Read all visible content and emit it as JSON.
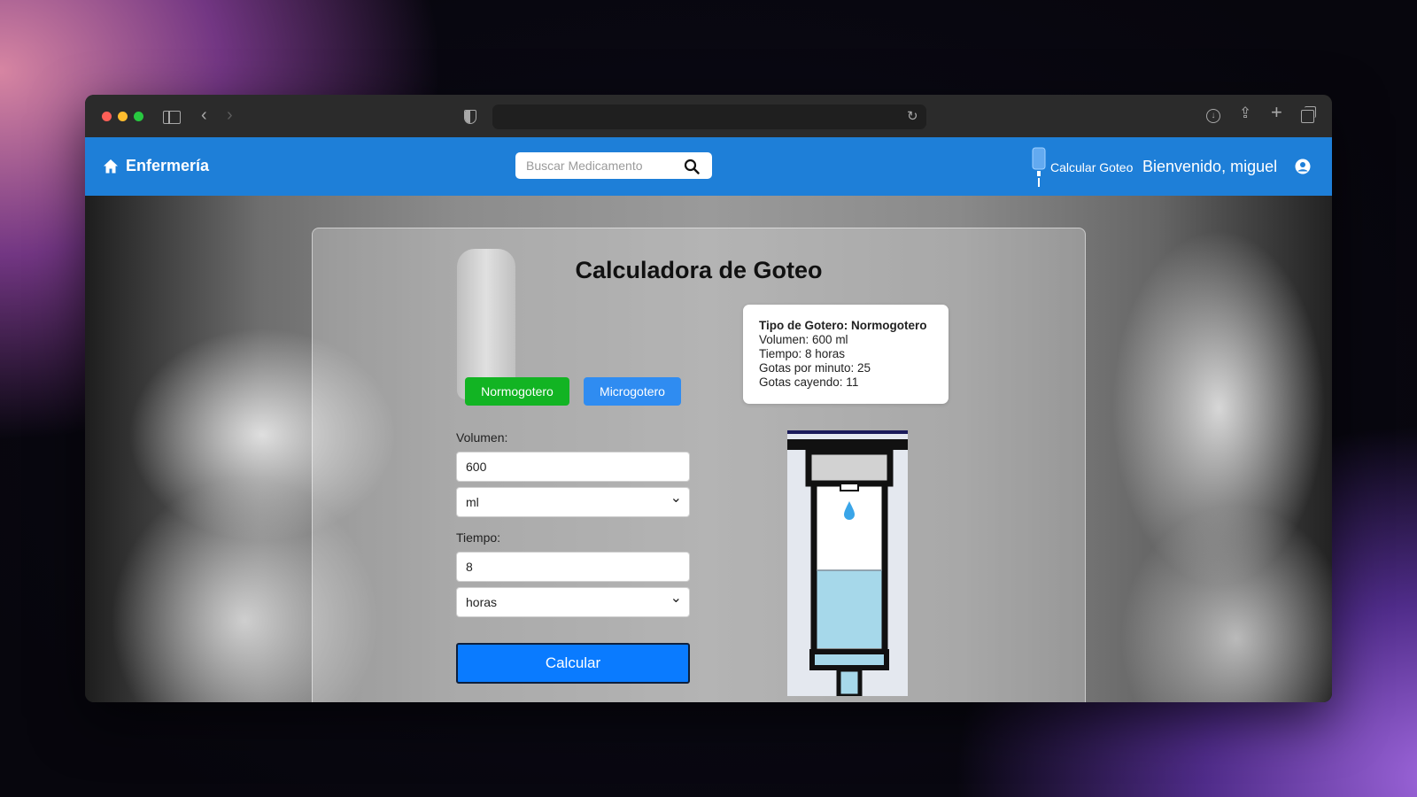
{
  "app": {
    "brand": "Enfermería",
    "search_placeholder": "Buscar Medicamento",
    "drip_link_label": "Calcular Goteo",
    "welcome_text": "Bienvenido, miguel"
  },
  "calculator": {
    "title": "Calculadora de Goteo",
    "types": [
      {
        "label": "Normogotero",
        "color": "#12b423"
      },
      {
        "label": "Microgotero",
        "color": "#2f8cf1"
      }
    ],
    "volume_label": "Volumen:",
    "volume_value": "600",
    "volume_unit": "ml",
    "time_label": "Tiempo:",
    "time_value": "8",
    "time_unit": "horas",
    "calculate_label": "Calcular"
  },
  "result": {
    "title": "Tipo de Gotero: Normogotero",
    "lines": [
      "Volumen: 600 ml",
      "Tiempo: 8 horas",
      "Gotas por minuto: 25",
      "Gotas cayendo: 11"
    ]
  },
  "colors": {
    "navbar": "#1e7fd8",
    "calculate_button": "#0a7bff",
    "fluid": "#a6d8ea"
  }
}
